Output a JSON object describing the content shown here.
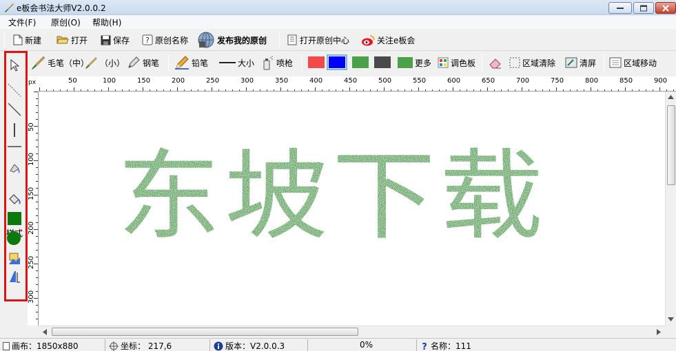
{
  "window": {
    "title": "e板会书法大师V2.0.0.2"
  },
  "menu": {
    "file": "文件(F)",
    "original": "原创(O)",
    "help": "帮助(H)"
  },
  "toolbar_main": {
    "new": "新建",
    "open": "打开",
    "save": "保存",
    "original_name": "原创名称",
    "publish": "发布我的原创",
    "open_center": "打开原创中心",
    "follow": "关注e板会"
  },
  "toolbar_tools": {
    "brush_medium": "毛笔（中）",
    "brush_small": "（小）",
    "pen": "钢笔",
    "pencil": "铅笔",
    "size": "大小",
    "spray": "喷枪",
    "more": "更多",
    "palette": "调色板",
    "clear_area": "区域清除",
    "clear_screen": "清屏",
    "move_area": "区域移动"
  },
  "colors": {
    "swatches": [
      "#f24a4a",
      "#0000ff",
      "#4aa14a",
      "#4a4a4a",
      "#4aa14a"
    ],
    "selected_index": 1,
    "ink": "#1f7a1f",
    "fill_square": "#0b7a0b",
    "fill_circle": "#0b7a0b",
    "highlight_frame": "#e01313"
  },
  "sidebar": {
    "style_label": "样式"
  },
  "ruler": {
    "unit": "px",
    "h_labels": [
      "50",
      "100",
      "150",
      "200",
      "250",
      "300",
      "350",
      "400",
      "450",
      "500",
      "550",
      "600",
      "650",
      "700",
      "750",
      "800",
      "850",
      "900"
    ],
    "v_labels": [
      "50",
      "100",
      "150",
      "200",
      "250",
      "300"
    ]
  },
  "canvas": {
    "artwork_text": "东坡下载"
  },
  "status": {
    "canvas_size": "画布：1850x880",
    "coords": "坐标： 217,6",
    "version": "版本：V2.0.0.3",
    "progress": "0%",
    "name": "名称：111"
  },
  "icons": {
    "app": "brush-icon",
    "new": "new-file-icon",
    "open": "folder-open-icon",
    "save": "floppy-icon",
    "original_name": "help-icon",
    "publish": "globe-icon",
    "open_center": "book-icon",
    "follow": "weibo-icon",
    "sidebar": [
      "pointer-icon",
      "dotted-line-icon",
      "diagonal-line-icon",
      "vertical-line-icon",
      "horizontal-line-icon",
      "paint-style-icon",
      "bucket-icon",
      "square-icon",
      "circle-icon",
      "image-tool-icon",
      "text-tool-icon"
    ]
  }
}
